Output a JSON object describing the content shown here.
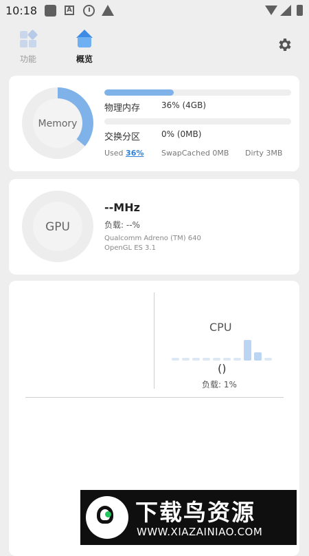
{
  "status_bar": {
    "time": "10:18",
    "icons": [
      "app-icon",
      "a-icon",
      "clock-icon",
      "warning-icon",
      "wifi-icon",
      "signal-icon",
      "battery-icon"
    ]
  },
  "nav": {
    "tabs": [
      {
        "label": "功能",
        "icon": "grid-icon",
        "active": false
      },
      {
        "label": "概览",
        "icon": "home-icon",
        "active": true
      }
    ],
    "settings_icon": "gear-icon"
  },
  "memory": {
    "ring_label": "Memory",
    "ring_fraction": 0.36,
    "physical": {
      "label": "物理内存",
      "value": "36% (4GB)",
      "fraction": 0.37
    },
    "swap": {
      "label": "交换分区",
      "value": "0% (0MB)",
      "fraction": 0.0
    },
    "footer": {
      "used_label": "Used",
      "used_value": "36%",
      "swapcached": "SwapCached 0MB",
      "dirty": "Dirty 3MB"
    }
  },
  "gpu": {
    "ring_label": "GPU",
    "frequency": "--MHz",
    "load": "负载: --%",
    "device": "Qualcomm Adreno (TM) 640",
    "api": "OpenGL ES 3.1"
  },
  "cpu": {
    "title": "CPU",
    "freq": "()",
    "load": "负载: 1%",
    "core_levels": [
      0.12,
      0.12,
      0.12,
      0.12,
      0.12,
      0.12,
      0.12,
      0.88,
      0.35,
      0.12
    ]
  },
  "watermark": {
    "title": "下载鸟资源",
    "url": "WWW.XIAZAINIAO.COM"
  },
  "colors": {
    "accent": "#7fb2e8",
    "track": "#eeeeee",
    "card": "#ffffff",
    "background": "#eeeeee"
  }
}
